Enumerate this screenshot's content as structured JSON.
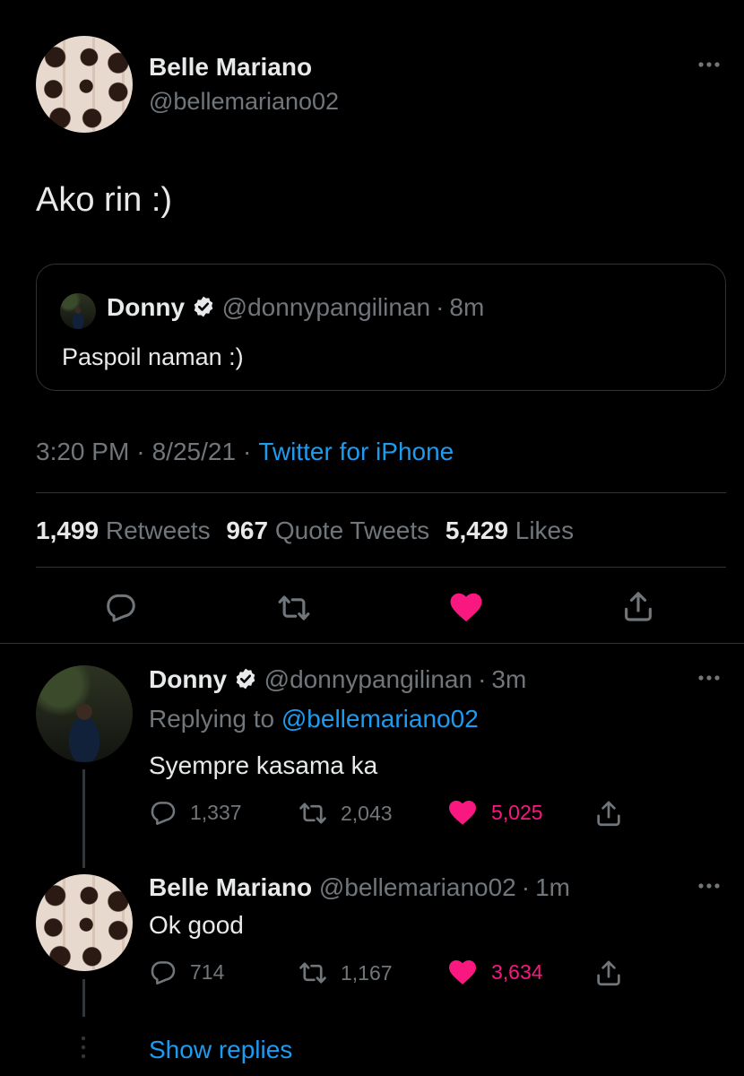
{
  "main_tweet": {
    "name": "Belle Mariano",
    "handle": "@bellemariano02",
    "text": "Ako rin :)",
    "quote": {
      "name": "Donny",
      "handle": "@donnypangilinan",
      "time": "8m",
      "text": "Paspoil naman :)"
    },
    "meta": {
      "time": "3:20 PM",
      "date": "8/25/21",
      "source": "Twitter for iPhone"
    },
    "stats": {
      "retweets": "1,499",
      "retweets_label": "Retweets",
      "quotes": "967",
      "quotes_label": "Quote Tweets",
      "likes": "5,429",
      "likes_label": "Likes"
    }
  },
  "replies": [
    {
      "name": "Donny",
      "handle": "@donnypangilinan",
      "time": "3m",
      "replying_prefix": "Replying to",
      "replying_handle": "@bellemariano02",
      "text": "Syempre kasama ka",
      "replies": "1,337",
      "retweets": "2,043",
      "likes": "5,025"
    },
    {
      "name": "Belle Mariano",
      "handle": "@bellemariano02",
      "time": "1m",
      "text": "Ok good",
      "replies": "714",
      "retweets": "1,167",
      "likes": "3,634"
    }
  ],
  "show_replies": "Show replies",
  "separator": "·",
  "icons": {
    "more": "more-horizontal-icon",
    "verified": "verified-badge-icon",
    "reply": "reply-icon",
    "retweet": "retweet-icon",
    "like": "like-icon",
    "share": "share-icon"
  },
  "colors": {
    "background": "#000000",
    "accent": "#1d9bf0",
    "like": "#f91880",
    "muted": "#71767b",
    "text": "#e7e9ea"
  }
}
